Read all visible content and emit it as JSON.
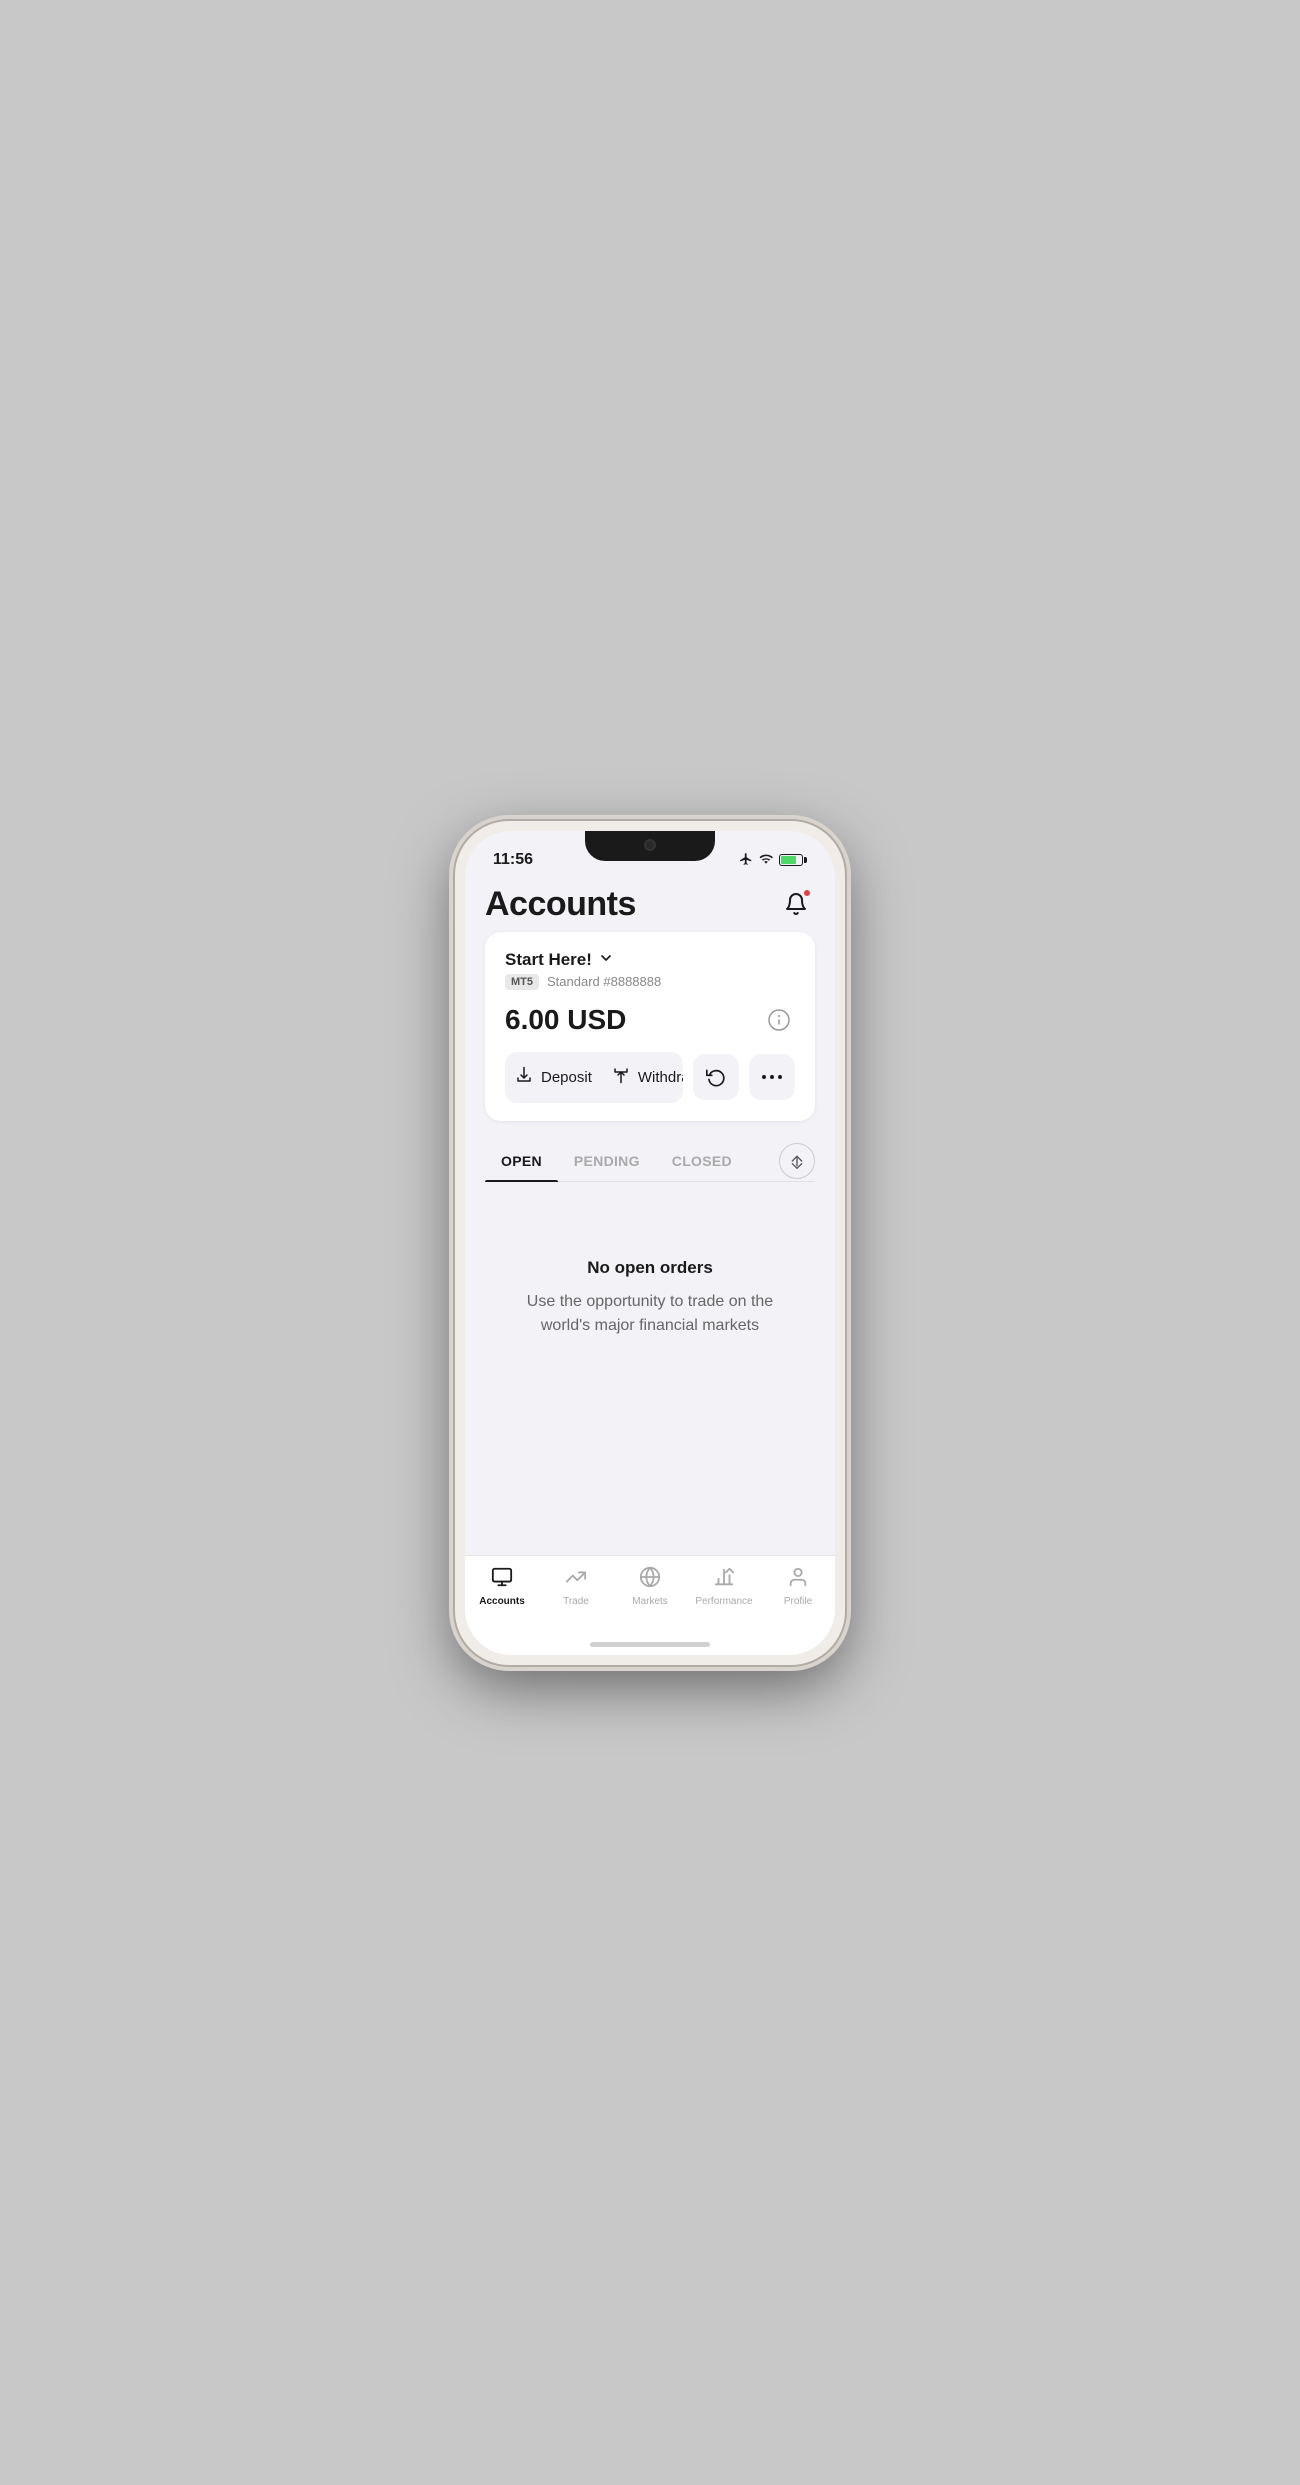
{
  "status": {
    "time": "11:56",
    "icons": [
      "airplane",
      "wifi",
      "battery"
    ]
  },
  "header": {
    "title": "Accounts",
    "notification_icon": "bell-icon"
  },
  "account_card": {
    "account_name": "Start Here!",
    "badge": "MT5",
    "account_type": "Standard #8888888",
    "balance": "6.00 USD",
    "deposit_label": "Deposit",
    "withdraw_label": "Withdraw"
  },
  "tabs": {
    "items": [
      {
        "label": "OPEN",
        "active": true
      },
      {
        "label": "PENDING",
        "active": false
      },
      {
        "label": "CLOSED",
        "active": false
      }
    ]
  },
  "empty_state": {
    "title": "No open orders",
    "subtitle": "Use the opportunity to trade on the world's major financial markets"
  },
  "bottom_nav": {
    "items": [
      {
        "label": "Accounts",
        "active": true,
        "icon": "accounts-icon"
      },
      {
        "label": "Trade",
        "active": false,
        "icon": "trade-icon"
      },
      {
        "label": "Markets",
        "active": false,
        "icon": "markets-icon"
      },
      {
        "label": "Performance",
        "active": false,
        "icon": "performance-icon"
      },
      {
        "label": "Profile",
        "active": false,
        "icon": "profile-icon"
      }
    ]
  }
}
